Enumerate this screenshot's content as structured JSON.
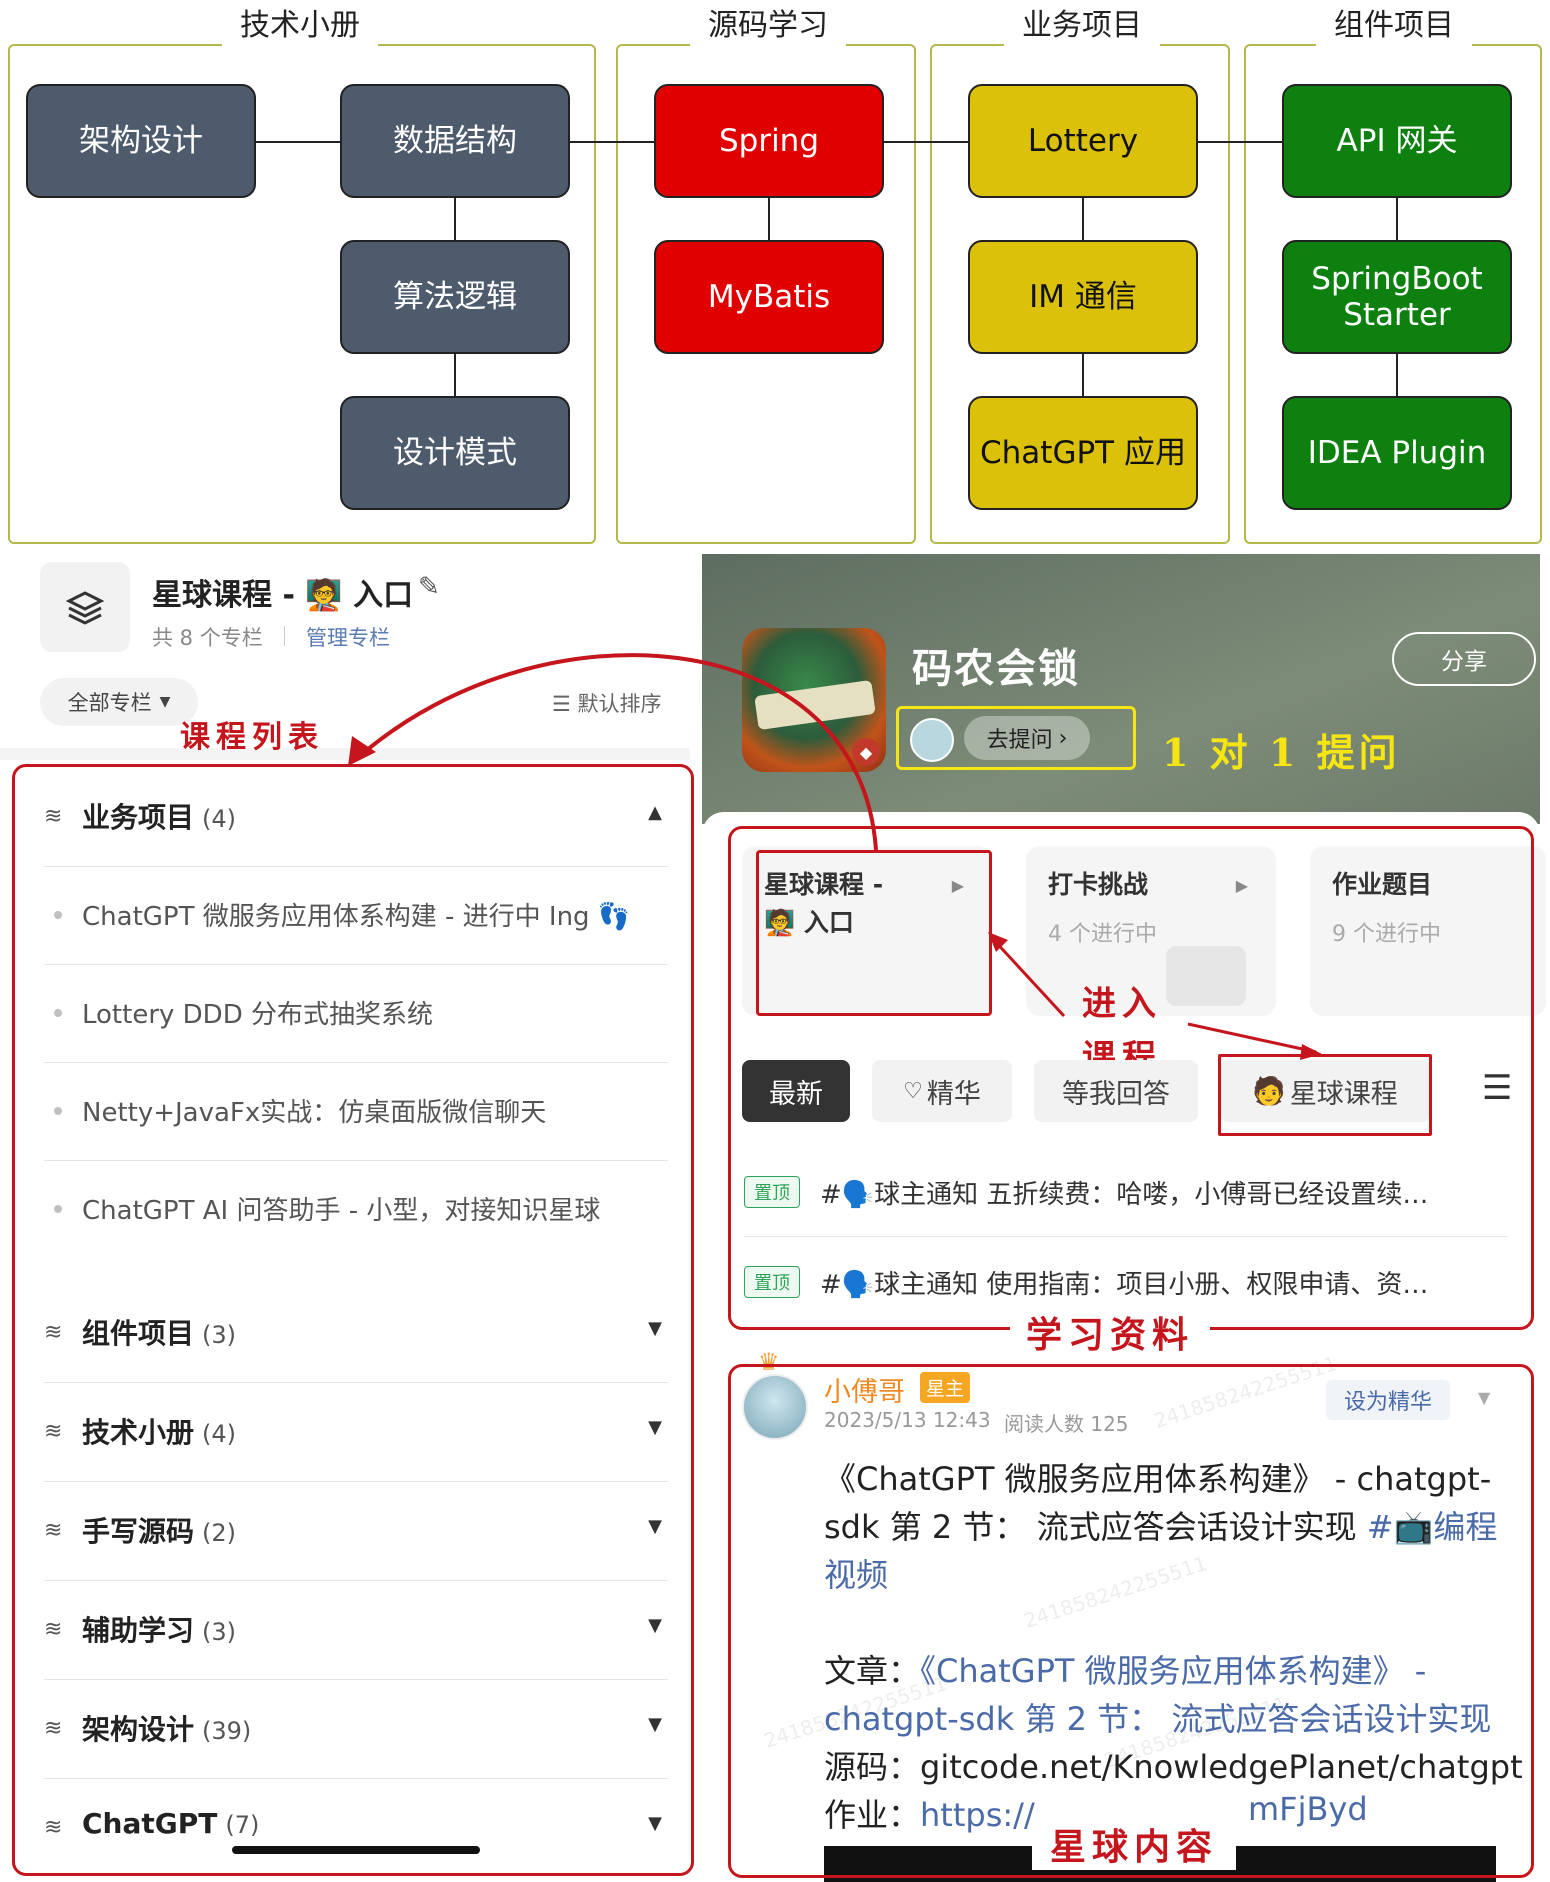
{
  "diagram": {
    "groups": [
      {
        "title": "技术小册",
        "nodes": [
          "架构设计",
          "数据结构",
          "算法逻辑",
          "设计模式"
        ]
      },
      {
        "title": "源码学习",
        "nodes": [
          "Spring",
          "MyBatis"
        ]
      },
      {
        "title": "业务项目",
        "nodes": [
          "Lottery",
          "IM 通信",
          "ChatGPT 应用"
        ]
      },
      {
        "title": "组件项目",
        "nodes": [
          "API 网关",
          "SpringBoot Starter",
          "IDEA Plugin"
        ]
      }
    ],
    "colors": {
      "slate": "#4e5b6c",
      "red": "#e10000",
      "gold": "#dcc10a",
      "green": "#0e8010",
      "frame": "#b5b84a"
    }
  },
  "left_panel": {
    "title": "星球课程 - 🧑‍🏫 入口",
    "edit_icon": "pencil-icon",
    "stats": "共 8 个专栏",
    "manage_link": "管理专栏",
    "filter": "全部专栏",
    "sort": "默认排序",
    "annotation": "课程列表",
    "expanded_category": {
      "name": "业务项目",
      "count": "(4)",
      "courses": [
        "ChatGPT 微服务应用体系构建 - 进行中 Ing 👣",
        "Lottery DDD 分布式抽奖系统",
        "Netty+JavaFx实战：仿桌面版微信聊天",
        "ChatGPT AI 问答助手 - 小型，对接知识星球"
      ]
    },
    "categories": [
      {
        "name": "组件项目",
        "count": "(3)"
      },
      {
        "name": "技术小册",
        "count": "(4)"
      },
      {
        "name": "手写源码",
        "count": "(2)"
      },
      {
        "name": "辅助学习",
        "count": "(3)"
      },
      {
        "name": "架构设计",
        "count": "(39)"
      },
      {
        "name": "ChatGPT",
        "count": "(7)"
      }
    ]
  },
  "right_panel": {
    "planet_name": "码农会锁",
    "share": "分享",
    "ask_button": "去提问",
    "ask_annotation": "1 对 1 提问",
    "cards": [
      {
        "title": "星球课程 - 🧑‍🏫 入口",
        "subtitle": ""
      },
      {
        "title": "打卡挑战",
        "subtitle": "4 个进行中"
      },
      {
        "title": "作业题目",
        "subtitle": "9 个进行中"
      }
    ],
    "enter_annotation_1": "进入",
    "enter_annotation_2": "课程",
    "tabs": {
      "latest": "最新",
      "featured": "精华",
      "waiting": "等我回答",
      "courses": "星球课程"
    },
    "pinned_label": "置顶",
    "pinned_posts": [
      "#🗣️球主通知 五折续费：哈喽，小傅哥已经设置续…",
      "#🗣️球主通知 使用指南：项目小册、权限申请、资…"
    ],
    "materials_annotation": "学习资料",
    "post": {
      "author": "小傅哥",
      "role": "星主",
      "time": "2023/5/13 12:43",
      "reads": "阅读人数 125",
      "set_featured": "设为精华",
      "line1": "《ChatGPT 微服务应用体系构建》 - chatgpt-",
      "line2": "sdk 第 2 节： 流式应答会话设计实现 ",
      "line2_tag": "#📺编程",
      "line3_tag": "视频",
      "article_label": "文章：",
      "article_link1": "《ChatGPT 微服务应用体系构建》 -",
      "article_link2": "chatgpt-sdk 第 2 节： 流式应答会话设计实现",
      "source_label": "源码：",
      "source_value": "gitcode.net/KnowledgePlanet/chatgpt",
      "homework_label": "作业：",
      "homework_value_start": "https://",
      "homework_value_end": "mFjByd"
    },
    "content_annotation": "星球内容",
    "watermark": "241858242255511"
  }
}
